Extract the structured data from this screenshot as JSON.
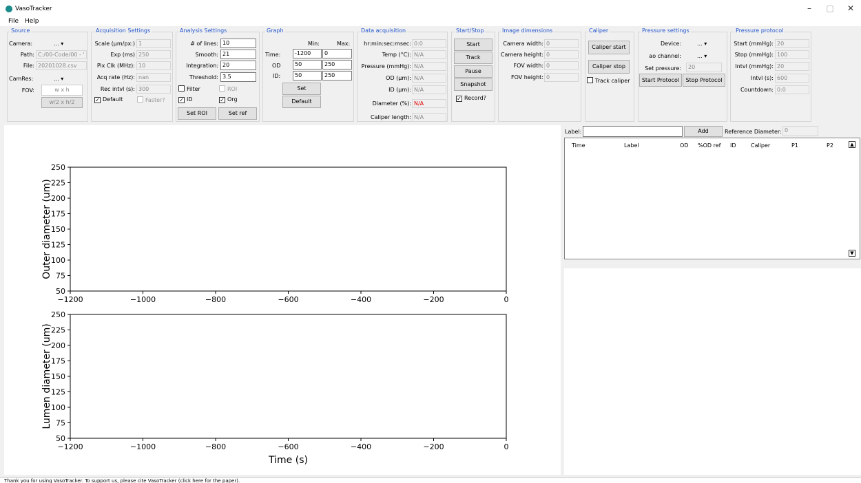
{
  "window": {
    "title": "VasoTracker",
    "minimize": "–",
    "maximize": "▢",
    "close": "✕"
  },
  "menu": [
    "File",
    "Help"
  ],
  "source": {
    "title": "Source",
    "camera_label": "Camera:",
    "camera_value": "...",
    "path_label": "Path:",
    "path_value": "C:/00-Code/00 - '",
    "file_label": "File:",
    "file_value": "20201028.csv",
    "camres_label": "CamRes:",
    "camres_value": "...",
    "fov_label": "FOV:",
    "fov_value": "w x h",
    "half_button": "w/2 x h/2"
  },
  "acquisition": {
    "title": "Acquisition Settings",
    "scale_label": "Scale (μm/px:)",
    "scale_value": "1",
    "exp_label": "Exp (ms)",
    "exp_value": "250",
    "pixclk_label": "Pix Clk (MHz):",
    "pixclk_value": "10",
    "acqrate_label": "Acq rate (Hz):",
    "acqrate_value": "nan",
    "recintvl_label": "Rec intvl (s):",
    "recintvl_value": "300",
    "default_label": "Default",
    "faster_label": "Faster?"
  },
  "analysis": {
    "title": "Analysis Settings",
    "lines_label": "# of lines:",
    "lines_value": "10",
    "smooth_label": "Smooth:",
    "smooth_value": "21",
    "integration_label": "Integration:",
    "integration_value": "20",
    "threshold_label": "Threshold:",
    "threshold_value": "3.5",
    "filter_label": "Filter",
    "roi_label": "ROI",
    "id_label": "ID",
    "org_label": "Org",
    "set_roi": "Set ROI",
    "set_ref": "Set ref"
  },
  "graph": {
    "title": "Graph",
    "min_label": "Min:",
    "max_label": "Max:",
    "time_label": "Time:",
    "time_min": "-1200",
    "time_max": "0",
    "od_label": "OD",
    "od_min": "50",
    "od_max": "250",
    "id_label": "ID:",
    "id_min": "50",
    "id_max": "250",
    "set_button": "Set",
    "default_button": "Default"
  },
  "data_acq": {
    "title": "Data acquisition",
    "time_label": "hr:min:sec:msec:",
    "time_value": "0:0",
    "temp_label": "Temp (°C):",
    "temp_value": "N/A",
    "pressure_label": "Pressure (mmHg):",
    "pressure_value": "N/A",
    "od_label": "OD (μm):",
    "od_value": "N/A",
    "id_label": "ID (μm):",
    "id_value": "N/A",
    "diameter_label": "Diameter (%):",
    "diameter_value": "N/A",
    "caliper_label": "Caliper length:",
    "caliper_value": "N/A"
  },
  "startstop": {
    "title": "Start/Stop",
    "start": "Start",
    "track": "Track",
    "pause": "Pause",
    "snapshot": "Snapshot",
    "record": "Record?"
  },
  "imgdim": {
    "title": "Image dimensions",
    "camw_label": "Camera width:",
    "camw_value": "0",
    "camh_label": "Camera height:",
    "camh_value": "0",
    "fovw_label": "FOV width:",
    "fovw_value": "0",
    "fovh_label": "FOV height:",
    "fovh_value": "0"
  },
  "caliper": {
    "title": "Caliper",
    "start": "Caliper start",
    "stop": "Caliper stop",
    "track": "Track caliper"
  },
  "pressure": {
    "title": "Pressure settings",
    "device_label": "Device:",
    "device_value": "...",
    "ao_label": "ao channel:",
    "ao_value": "...",
    "set_label": "Set pressure:",
    "set_value": "20",
    "start_protocol": "Start Protocol",
    "stop_protocol": "Stop Protocol"
  },
  "protocol": {
    "title": "Pressure protocol",
    "start_label": "Start (mmHg):",
    "start_value": "20",
    "stop_label": "Stop (mmHg):",
    "stop_value": "100",
    "intvl_label": "Intvl (mmHg):",
    "intvl_value": "20",
    "intvls_label": "Intvl (s):",
    "intvls_value": "600",
    "countdown_label": "Countdown:",
    "countdown_value": "0:0"
  },
  "table": {
    "label_label": "Label:",
    "label_value": "",
    "add_button": "Add",
    "refdiam_label": "Reference Diameter:",
    "refdiam_value": "0",
    "columns": [
      "Time",
      "Label",
      "OD",
      "%OD ref",
      "ID",
      "Caliper",
      "P1",
      "P2"
    ]
  },
  "status_text": "Thank you for using VasoTracker. To support us, please cite VasoTracker (click here for the paper).",
  "chart_data": [
    {
      "type": "line",
      "title": "",
      "xlabel": "",
      "ylabel": "Outer diameter (um)",
      "xlim": [
        -1200,
        0
      ],
      "ylim": [
        50,
        250
      ],
      "x_ticks": [
        -1200,
        -1000,
        -800,
        -600,
        -400,
        -200,
        0
      ],
      "y_ticks": [
        50,
        75,
        100,
        125,
        150,
        175,
        200,
        225,
        250
      ],
      "x_tick_labels": [
        "−1200",
        "−1000",
        "−800",
        "−600",
        "−400",
        "−200",
        "0"
      ],
      "series": []
    },
    {
      "type": "line",
      "title": "",
      "xlabel": "Time (s)",
      "ylabel": "Lumen diameter (um)",
      "xlim": [
        -1200,
        0
      ],
      "ylim": [
        50,
        250
      ],
      "x_ticks": [
        -1200,
        -1000,
        -800,
        -600,
        -400,
        -200,
        0
      ],
      "y_ticks": [
        50,
        75,
        100,
        125,
        150,
        175,
        200,
        225,
        250
      ],
      "x_tick_labels": [
        "−1200",
        "−1000",
        "−800",
        "−600",
        "−400",
        "−200",
        "0"
      ],
      "series": []
    }
  ]
}
